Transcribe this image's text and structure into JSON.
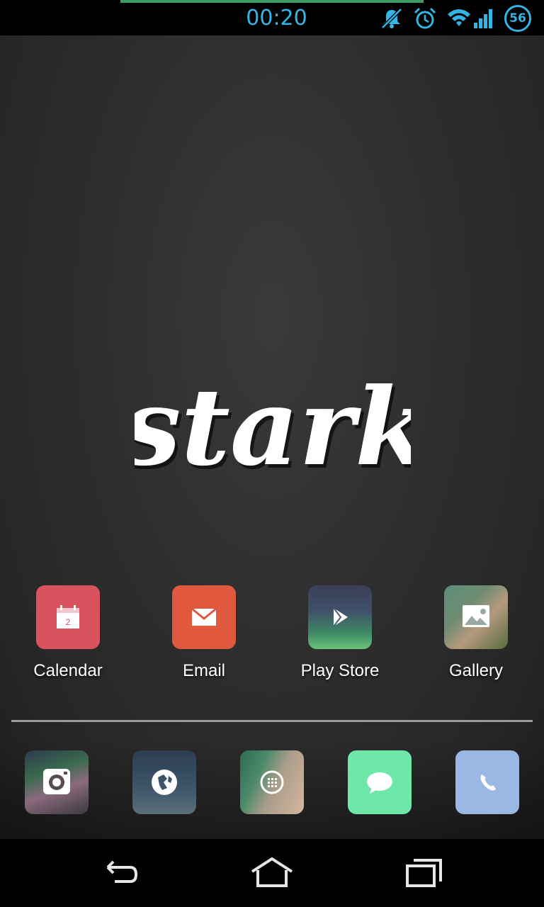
{
  "status_bar": {
    "time": "00:20",
    "battery_level": "56",
    "icons": [
      "notifications-muted-icon",
      "alarm-icon",
      "wifi-icon",
      "cell-signal-icon",
      "battery-icon"
    ],
    "accent_color": "#33b5e5"
  },
  "wallpaper": {
    "logo_text": "stark"
  },
  "apps": [
    {
      "label": "Calendar",
      "icon": "calendar-icon",
      "calendar_day": "2",
      "color": "#d9535e"
    },
    {
      "label": "Email",
      "icon": "email-icon",
      "color": "#e0593f"
    },
    {
      "label": "Play Store",
      "icon": "play-store-icon"
    },
    {
      "label": "Gallery",
      "icon": "gallery-icon"
    }
  ],
  "dock": [
    {
      "icon": "camera-icon"
    },
    {
      "icon": "browser-icon"
    },
    {
      "icon": "app-drawer-icon"
    },
    {
      "icon": "messaging-icon",
      "color": "#6ee8a9"
    },
    {
      "icon": "phone-icon",
      "color": "#9ab8e3"
    }
  ],
  "nav_bar": {
    "buttons": [
      "back-icon",
      "home-icon",
      "recents-icon"
    ]
  }
}
